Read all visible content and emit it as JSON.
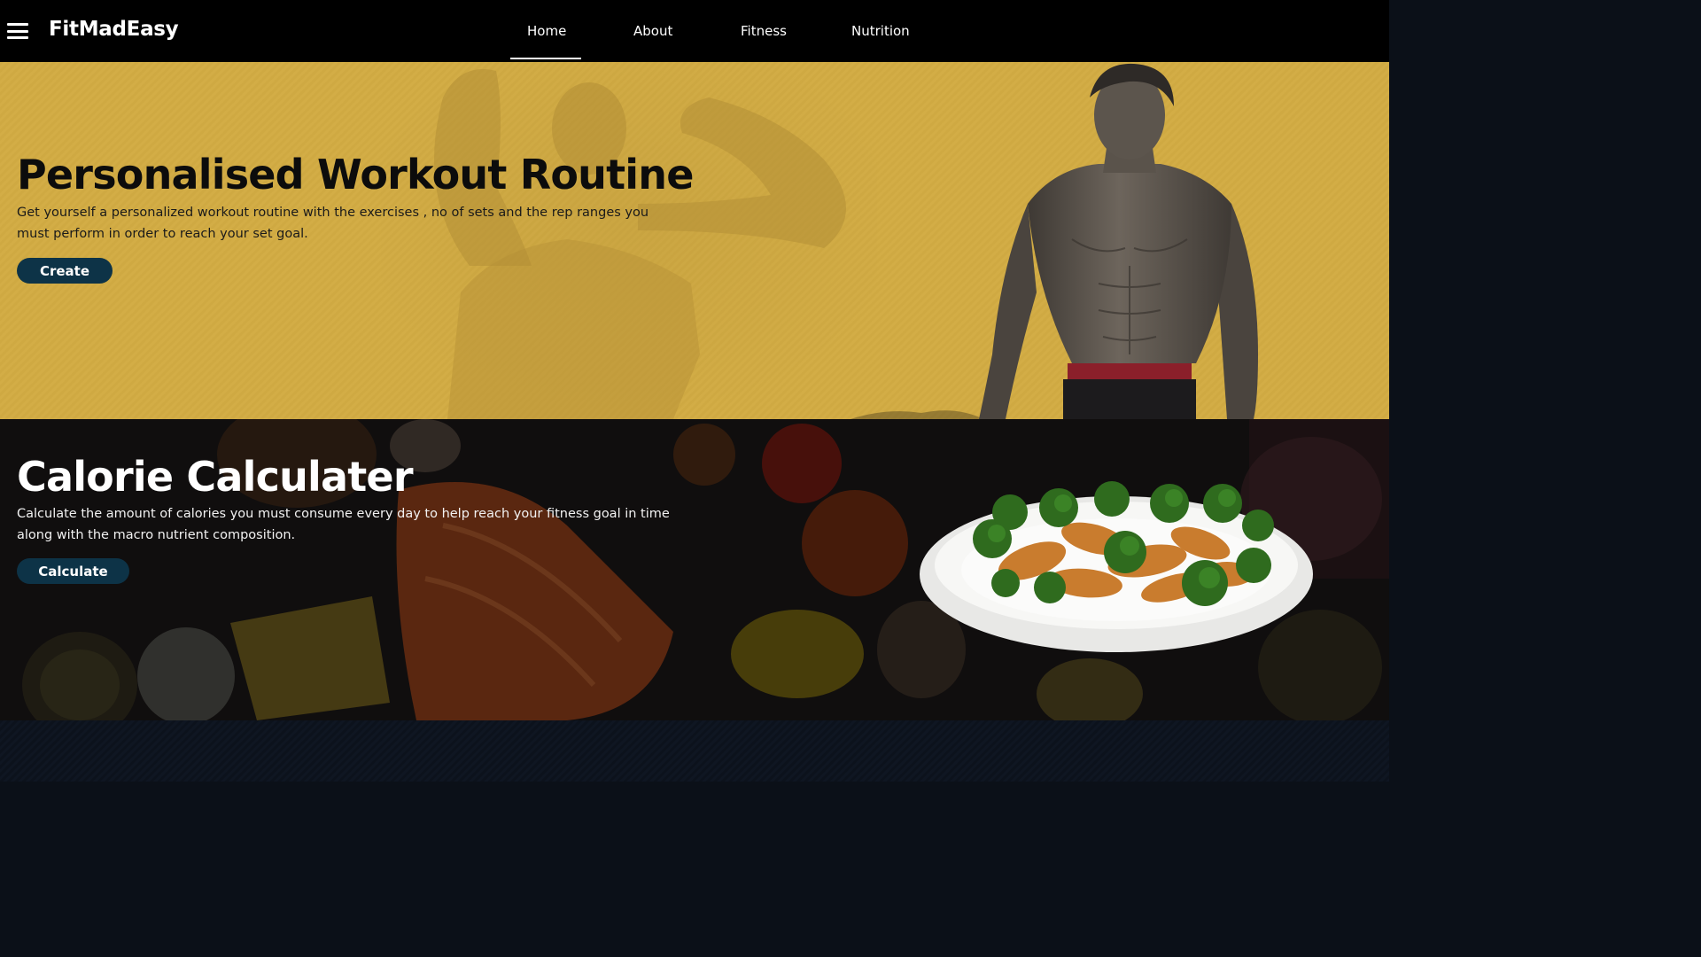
{
  "navbar": {
    "brand": "FitMadEasy",
    "links": [
      "Home",
      "About",
      "Fitness",
      "Nutrition"
    ],
    "active_link": "Home"
  },
  "icons": {
    "menu": "hamburger-menu-icon"
  },
  "workout_section": {
    "title": "Personalised Workout Routine",
    "description": "Get yourself a personalized workout routine with the exercises , no of sets and the rep ranges you must perform in order to reach your set goal.",
    "button_label": "Create",
    "background_color": "#d3ad46"
  },
  "calorie_section": {
    "title": "Calorie Calculater",
    "description": "Calculate the amount of calories you must consume every day to help reach your fitness goal in time along with the macro nutrient composition.",
    "button_label": "Calculate"
  },
  "colors": {
    "navbar_bg": "#000000",
    "button_bg": "#0d3347",
    "footer_bg": "#0c121c"
  }
}
